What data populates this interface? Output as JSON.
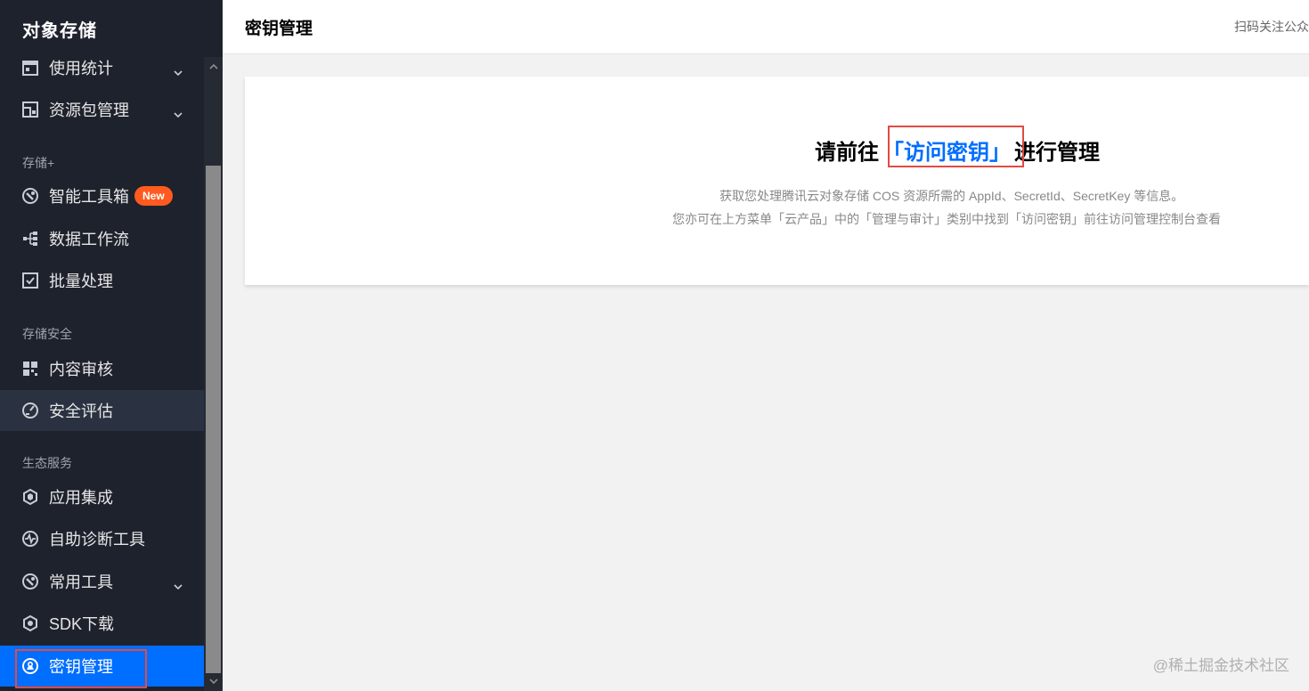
{
  "sidebar": {
    "product_title": "对象存储",
    "items_top": [
      {
        "label": "使用统计",
        "icon": "calendar-icon",
        "has_chevron": true
      },
      {
        "label": "资源包管理",
        "icon": "package-icon",
        "has_chevron": true
      }
    ],
    "group_storage_plus": "存储+",
    "items_storage_plus": [
      {
        "label": "智能工具箱",
        "icon": "toolbox-icon",
        "badge": "New"
      },
      {
        "label": "数据工作流",
        "icon": "workflow-icon"
      },
      {
        "label": "批量处理",
        "icon": "batch-icon"
      }
    ],
    "group_security": "存储安全",
    "items_security": [
      {
        "label": "内容审核",
        "icon": "grid-icon"
      },
      {
        "label": "安全评估",
        "icon": "gauge-icon"
      }
    ],
    "group_ecosystem": "生态服务",
    "items_ecosystem": [
      {
        "label": "应用集成",
        "icon": "cube-icon"
      },
      {
        "label": "自助诊断工具",
        "icon": "pulse-icon"
      },
      {
        "label": "常用工具",
        "icon": "tool-icon",
        "has_chevron": true
      },
      {
        "label": "SDK下载",
        "icon": "sdk-icon"
      },
      {
        "label": "密钥管理",
        "icon": "key-icon",
        "active": true
      }
    ],
    "accent_color": "#006eff"
  },
  "header": {
    "title": "密钥管理",
    "right_text": "扫码关注公众"
  },
  "card": {
    "prefix": "请前往",
    "link_text": "「访问密钥」",
    "suffix": "进行管理",
    "desc_line1": "获取您处理腾讯云对象存储 COS 资源所需的 AppId、SecretId、SecretKey 等信息。",
    "desc_line2": "您亦可在上方菜单「云产品」中的「管理与审计」类别中找到「访问密钥」前往访问管理控制台查看"
  },
  "watermark": "@稀土掘金技术社区"
}
